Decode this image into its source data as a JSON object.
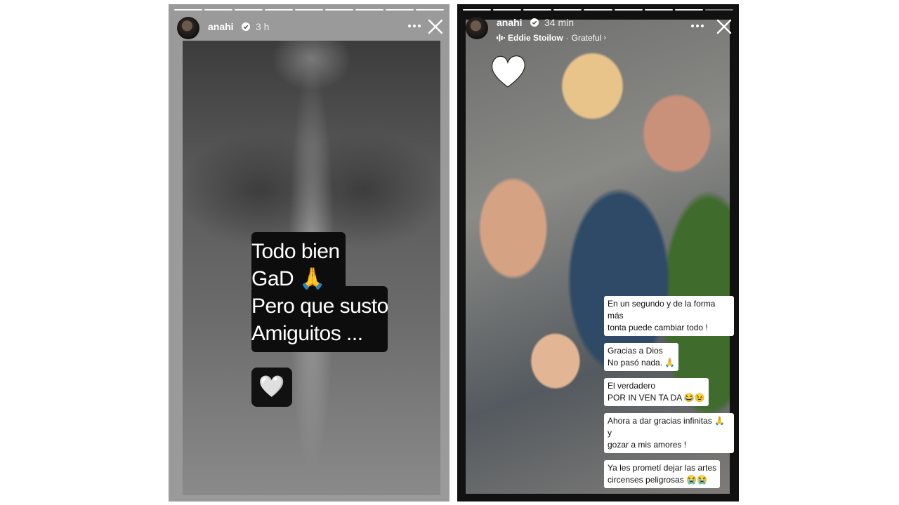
{
  "left_story": {
    "username": "anahi",
    "time": "3 h",
    "caption_lines": [
      "Todo bien",
      "GaD 🙏",
      "Pero que susto",
      "Amiguitos ..."
    ],
    "sticker": "🤍",
    "progress_segments": 9,
    "progress_filled": 9
  },
  "right_story": {
    "username": "anahi",
    "time": "34 min",
    "music": {
      "artist": "Eddie Stoilow",
      "separator": "·",
      "track": "Grateful"
    },
    "progress_segments": 9,
    "progress_filled": 8,
    "notes": [
      {
        "lines": [
          "En un segundo y de la forma más",
          "tonta puede cambiar todo !"
        ]
      },
      {
        "lines": [
          "Gracias a Dios",
          "No pasó nada. 🙏"
        ]
      },
      {
        "lines": [
          "El verdadero",
          "POR IN VEN TA DA 😂😉"
        ]
      },
      {
        "lines": [
          "Ahora a dar gracias infinitas 🙏 y",
          "gozar a mis amores !"
        ]
      },
      {
        "lines": [
          "Ya les prometí dejar las artes",
          "circenses peligrosas 😭😭"
        ]
      }
    ]
  },
  "colors": {
    "verified": "#3897f0",
    "story_bg_left": "#9a9a9a",
    "story_bg_right": "#111111"
  },
  "icons": [
    "verified-badge-icon",
    "more-options-icon",
    "close-icon",
    "music-bars-icon",
    "heart-icon"
  ]
}
